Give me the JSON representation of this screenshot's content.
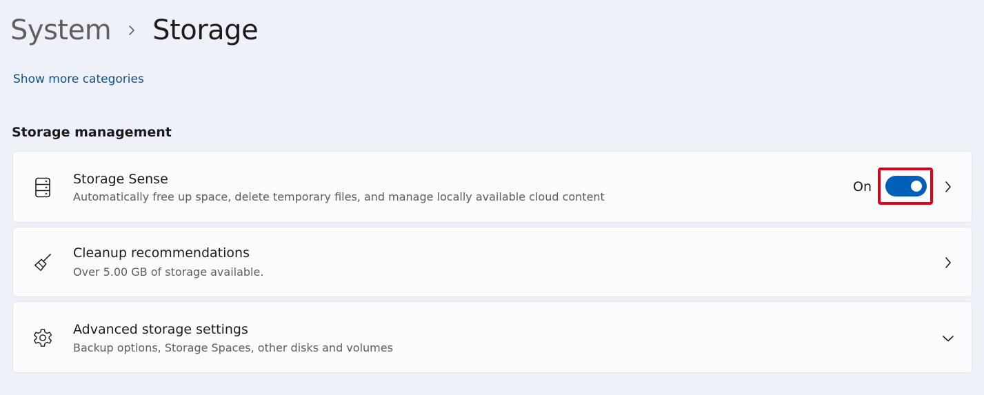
{
  "breadcrumb": {
    "parent": "System",
    "current": "Storage"
  },
  "links": {
    "show_more": "Show more categories"
  },
  "section": {
    "title": "Storage management"
  },
  "cards": {
    "storage_sense": {
      "title": "Storage Sense",
      "description": "Automatically free up space, delete temporary files, and manage locally available cloud content",
      "toggle_label": "On",
      "toggle_on": true,
      "icon": "hard-drive-icon"
    },
    "cleanup": {
      "title": "Cleanup recommendations",
      "description": "Over 5.00 GB of storage available.",
      "icon": "broom-icon"
    },
    "advanced": {
      "title": "Advanced storage settings",
      "description": "Backup options, Storage Spaces, other disks and volumes",
      "icon": "gear-icon"
    }
  },
  "colors": {
    "accent": "#005fb8",
    "link": "#0b4f8c",
    "highlight": "#e1001a",
    "background": "#eef2f8",
    "card": "#fbfcfe"
  }
}
